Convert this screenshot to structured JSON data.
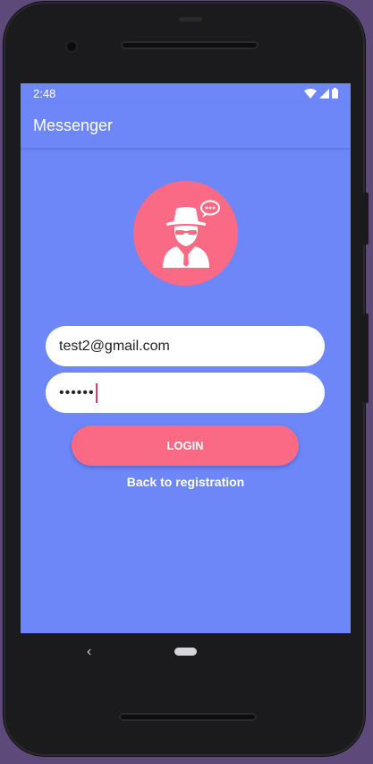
{
  "status_bar": {
    "time": "2:48"
  },
  "app_bar": {
    "title": "Messenger"
  },
  "login_form": {
    "email_value": "test2@gmail.com",
    "password_value": "••••••",
    "login_button_label": "LOGIN",
    "back_link_label": "Back to registration"
  },
  "colors": {
    "screen_background": "#6d87f8",
    "accent": "#fb6a85"
  },
  "icons": {
    "avatar": "spy-agent-chat-icon",
    "nav_back": "chevron-left-icon",
    "nav_home": "home-pill-icon"
  }
}
